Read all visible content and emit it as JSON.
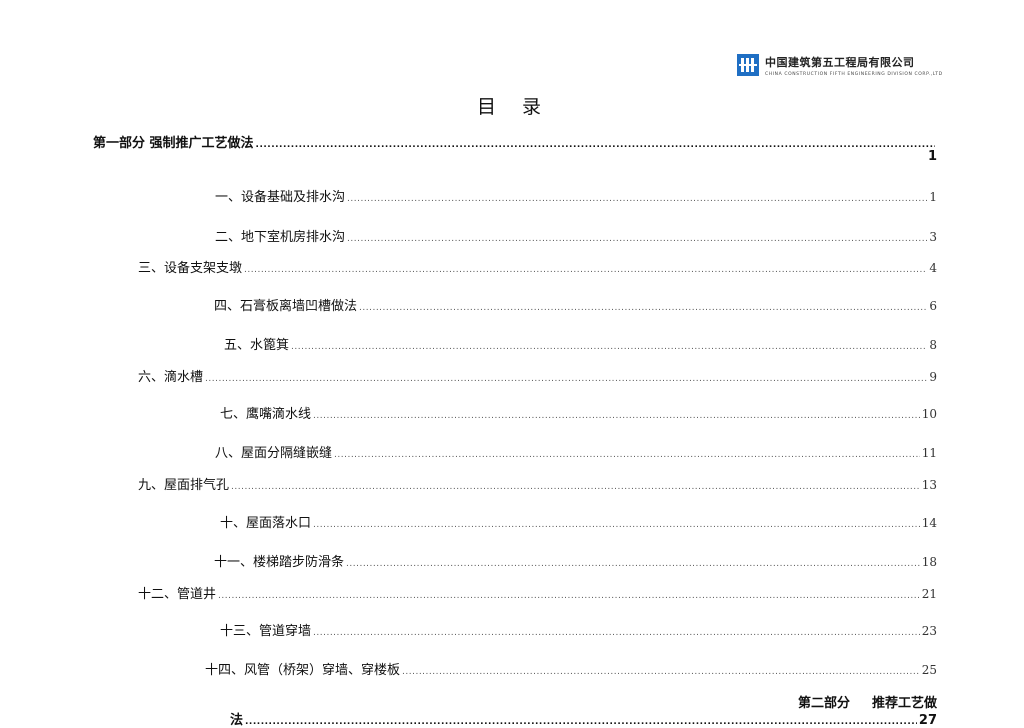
{
  "header": {
    "company_cn": "中国建筑第五工程局有限公司",
    "company_en": "CHINA CONSTRUCTION FIFTH ENGINEERING DIVISION CORP.,LTD"
  },
  "toc_title": [
    "目",
    "录"
  ],
  "part1": {
    "title": "第一部分 强制推广工艺做法",
    "page": "1"
  },
  "entries": [
    {
      "label": "一、设备基础及排水沟",
      "page": "1"
    },
    {
      "label": "二、地下室机房排水沟",
      "page": "3"
    },
    {
      "label": "三、设备支架支墩",
      "page": "4"
    },
    {
      "label": "四、石膏板离墙凹槽做法",
      "page": "6"
    },
    {
      "label": "五、水篦箕",
      "page": "8"
    },
    {
      "label": "六、滴水槽",
      "page": "9"
    },
    {
      "label": "七、鹰嘴滴水线",
      "page": "10"
    },
    {
      "label": "八、屋面分隔缝嵌缝",
      "page": "11"
    },
    {
      "label": "九、屋面排气孔",
      "page": "13"
    },
    {
      "label": "十、屋面落水口",
      "page": "14"
    },
    {
      "label": "十一、楼梯踏步防滑条",
      "page": "18"
    },
    {
      "label": "十二、管道井",
      "page": "21"
    },
    {
      "label": "十三、管道穿墙",
      "page": "23"
    },
    {
      "label": "十四、风管（桥架）穿墙、穿楼板",
      "page": "25"
    }
  ],
  "part2": {
    "title_a": "第二部分",
    "title_b": "推荐工艺做",
    "title_c": "法",
    "page": "27"
  }
}
